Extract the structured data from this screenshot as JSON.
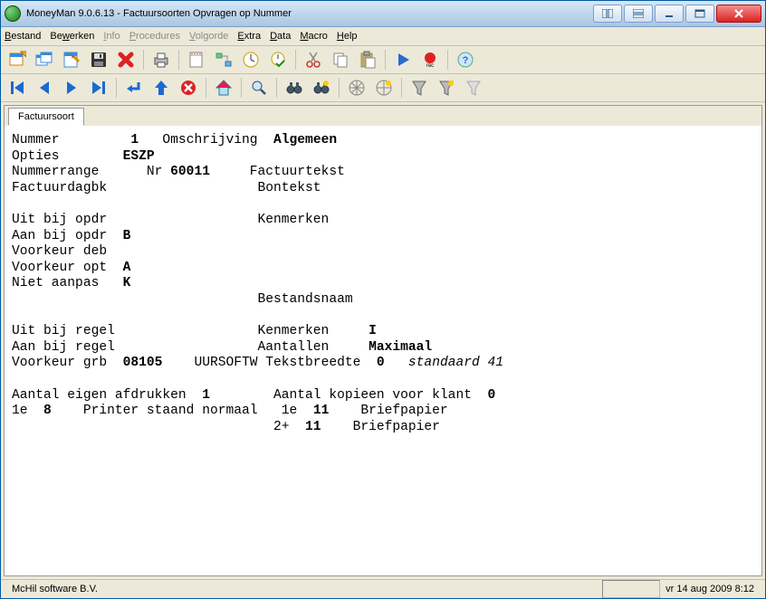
{
  "window": {
    "title": "MoneyMan 9.0.6.13 - Factuursoorten Opvragen op Nummer"
  },
  "menu": {
    "bestand": "Bestand",
    "bewerken": "Bewerken",
    "info": "Info",
    "procedures": "Procedures",
    "volgorde": "Volgorde",
    "extra": "Extra",
    "data": "Data",
    "macro": "Macro",
    "help": "Help"
  },
  "tab": {
    "label": "Factuursoort"
  },
  "fields": {
    "nummer_label": "Nummer",
    "nummer_value": "1",
    "omschrijving_label": "Omschrijving",
    "omschrijving_value": "Algemeen",
    "opties_label": "Opties",
    "opties_value": "ESZP",
    "nummerrange_label": "Nummerrange",
    "nummerrange_nr": "Nr",
    "nummerrange_value": "60011",
    "factuurtekst_label": "Factuurtekst",
    "factuurdagbk_label": "Factuurdagbk",
    "bontekst_label": "Bontekst",
    "uit_bij_opdr_label": "Uit bij opdr",
    "kenmerken_label": "Kenmerken",
    "aan_bij_opdr_label": "Aan bij opdr",
    "aan_bij_opdr_value": "B",
    "voorkeur_deb_label": "Voorkeur deb",
    "voorkeur_opt_label": "Voorkeur opt",
    "voorkeur_opt_value": "A",
    "niet_aanpas_label": "Niet aanpas",
    "niet_aanpas_value": "K",
    "bestandsnaam_label": "Bestandsnaam",
    "uit_bij_regel_label": "Uit bij regel",
    "kenmerken2_label": "Kenmerken",
    "kenmerken2_value": "I",
    "aan_bij_regel_label": "Aan bij regel",
    "aantallen_label": "Aantallen",
    "aantallen_value": "Maximaal",
    "voorkeur_grb_label": "Voorkeur grb",
    "voorkeur_grb_value": "08105",
    "voorkeur_grb_desc": "UURSOFTW",
    "tekstbreedte_label": "Tekstbreedte",
    "tekstbreedte_value": "0",
    "tekstbreedte_std": "standaard 41",
    "aantal_eigen_label": "Aantal eigen afdrukken",
    "aantal_eigen_value": "1",
    "aantal_kopieen_label": "Aantal kopieen voor klant",
    "aantal_kopieen_value": "0",
    "eigen_1e_label": "1e",
    "eigen_1e_value": "8",
    "eigen_1e_desc": "Printer staand normaal",
    "klant_1e_label": "1e",
    "klant_1e_value": "11",
    "klant_1e_desc": "Briefpapier",
    "klant_2_label": "2+",
    "klant_2_value": "11",
    "klant_2_desc": "Briefpapier"
  },
  "status": {
    "company": "McHil software B.V.",
    "datetime": "vr 14 aug 2009 8:12"
  }
}
